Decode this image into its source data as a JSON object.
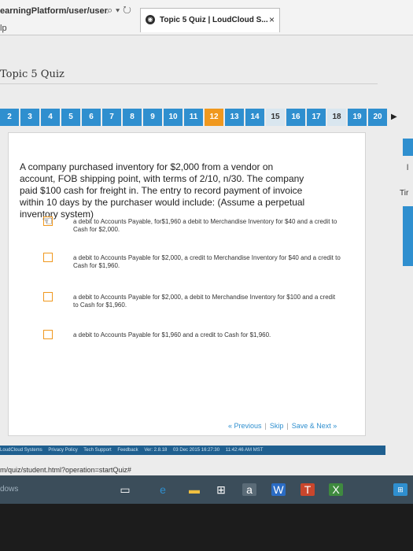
{
  "browser": {
    "url": "earningPlatform/user/user",
    "tab_title": "Topic 5 Quiz | LoudCloud S...",
    "tab_close": "×",
    "menu_fragment": "lp",
    "status_url": "m/quiz/student.html?operation=startQuiz#"
  },
  "page": {
    "title": "Topic 5 Quiz"
  },
  "question_nav": {
    "numbers": [
      "2",
      "3",
      "4",
      "5",
      "6",
      "7",
      "8",
      "9",
      "10",
      "11",
      "12",
      "13",
      "14",
      "15",
      "16",
      "17",
      "18",
      "19",
      "20"
    ],
    "current": "12",
    "unvisited": [
      "15",
      "18"
    ]
  },
  "question": {
    "stem": "A company purchased inventory for $2,000 from a vendor on account, FOB shipping point, with terms of 2/10, n/30. The company paid $100 cash for freight in. The entry to record payment of invoice within 10 days by the purchaser would include: (Assume a perpetual inventory system)",
    "options": [
      "a debit to Accounts Payable, for$1,960 a debit to Merchandise Inventory for $40 and a credit to Cash for $2,000.",
      "a debit to Accounts Payable for $2,000, a credit to Merchandise Inventory for $40 and a credit to Cash for $1,960.",
      "a debit to Accounts Payable for $2,000, a debit to Merchandise Inventory for $100 and a credit to Cash for $1,960.",
      "a debit to Accounts Payable for $1,960 and a credit to Cash for $1,960."
    ]
  },
  "controls": {
    "previous": "« Previous",
    "skip": "Skip",
    "save_next": "Save & Next »"
  },
  "footer": {
    "brand": "LoudCloud Systems",
    "privacy": "Privacy Policy",
    "support": "Tech Support",
    "feedback": "Feedback",
    "version": "Ver: 2.8.18",
    "date": "03 Dec 2015 16:27:30",
    "time": "11:42:46 AM MST"
  },
  "taskbar": {
    "search_fragment": "dows"
  },
  "side": {
    "fragment": "Tir"
  },
  "colors": {
    "accent_blue": "#2f8fcf",
    "current_orange": "#f0981e"
  }
}
